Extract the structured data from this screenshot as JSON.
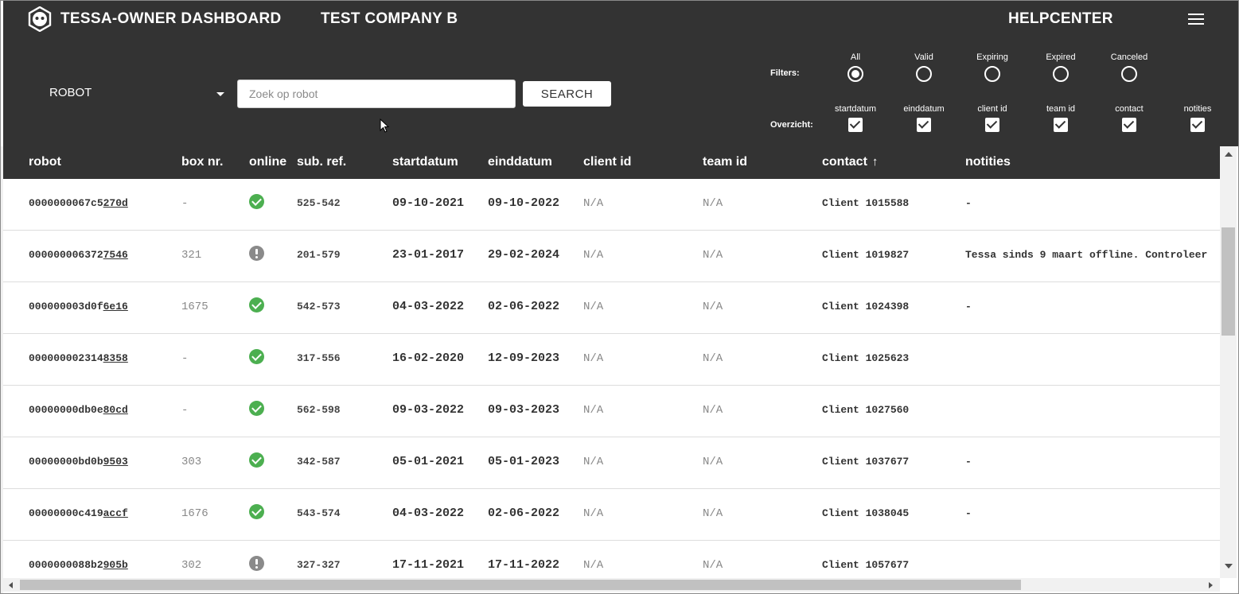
{
  "header": {
    "app_title": "TESSA-OWNER DASHBOARD",
    "company": "TEST COMPANY B",
    "helpcenter": "HELPCENTER",
    "menu_icon": "hamburger-menu-icon",
    "logo_icon": "tessa-logo-icon"
  },
  "search": {
    "category_value": "ROBOT",
    "placeholder": "Zoek op robot",
    "value": "",
    "button_label": "SEARCH"
  },
  "filters": {
    "label": "Filters:",
    "options": [
      {
        "label": "All",
        "selected": true
      },
      {
        "label": "Valid",
        "selected": false
      },
      {
        "label": "Expiring",
        "selected": false
      },
      {
        "label": "Expired",
        "selected": false
      },
      {
        "label": "Canceled",
        "selected": false
      }
    ]
  },
  "overzicht": {
    "label": "Overzicht:",
    "options": [
      {
        "label": "startdatum",
        "checked": true
      },
      {
        "label": "einddatum",
        "checked": true
      },
      {
        "label": "client id",
        "checked": true
      },
      {
        "label": "team id",
        "checked": true
      },
      {
        "label": "contact",
        "checked": true
      },
      {
        "label": "notities",
        "checked": true
      }
    ]
  },
  "table": {
    "columns": [
      "robot",
      "box nr.",
      "online",
      "sub. ref.",
      "startdatum",
      "einddatum",
      "client id",
      "team id",
      "contact",
      "notities"
    ],
    "sort_icon": "arrow-up-icon",
    "rows": [
      {
        "robot_prefix": "0000000067c5",
        "robot_suffix": "270d",
        "box": "-",
        "online": "ok",
        "sub": "525-542",
        "start": "09-10-2021",
        "end": "09-10-2022",
        "client": "N/A",
        "team": "N/A",
        "contact": "Client 1015588",
        "notes": "-"
      },
      {
        "robot_prefix": "000000006372",
        "robot_suffix": "7546",
        "box": "321",
        "online": "warn",
        "sub": "201-579",
        "start": "23-01-2017",
        "end": "29-02-2024",
        "client": "N/A",
        "team": "N/A",
        "contact": "Client 1019827",
        "notes": "Tessa sinds 9 maart offline. Controleer"
      },
      {
        "robot_prefix": "000000003d0f",
        "robot_suffix": "6e16",
        "box": "1675",
        "online": "ok",
        "sub": "542-573",
        "start": "04-03-2022",
        "end": "02-06-2022",
        "client": "N/A",
        "team": "N/A",
        "contact": "Client 1024398",
        "notes": "-"
      },
      {
        "robot_prefix": "000000002314",
        "robot_suffix": "8358",
        "box": "-",
        "online": "ok",
        "sub": "317-556",
        "start": "16-02-2020",
        "end": "12-09-2023",
        "client": "N/A",
        "team": "N/A",
        "contact": "Client 1025623",
        "notes": ""
      },
      {
        "robot_prefix": "00000000db0e",
        "robot_suffix": "80cd",
        "box": "-",
        "online": "ok",
        "sub": "562-598",
        "start": "09-03-2022",
        "end": "09-03-2023",
        "client": "N/A",
        "team": "N/A",
        "contact": "Client 1027560",
        "notes": ""
      },
      {
        "robot_prefix": "00000000bd0b",
        "robot_suffix": "9503",
        "box": "303",
        "online": "ok",
        "sub": "342-587",
        "start": "05-01-2021",
        "end": "05-01-2023",
        "client": "N/A",
        "team": "N/A",
        "contact": "Client 1037677",
        "notes": "-"
      },
      {
        "robot_prefix": "00000000c419",
        "robot_suffix": "accf",
        "box": "1676",
        "online": "ok",
        "sub": "543-574",
        "start": "04-03-2022",
        "end": "02-06-2022",
        "client": "N/A",
        "team": "N/A",
        "contact": "Client 1038045",
        "notes": "-"
      },
      {
        "robot_prefix": "0000000088b2",
        "robot_suffix": "905b",
        "box": "302",
        "online": "warn",
        "sub": "327-327",
        "start": "17-11-2021",
        "end": "17-11-2022",
        "client": "N/A",
        "team": "N/A",
        "contact": "Client 1057677",
        "notes": ""
      }
    ]
  },
  "colors": {
    "header_bg": "#333333",
    "online_ok": "#4caf50",
    "online_warn": "#8a8a8a"
  }
}
